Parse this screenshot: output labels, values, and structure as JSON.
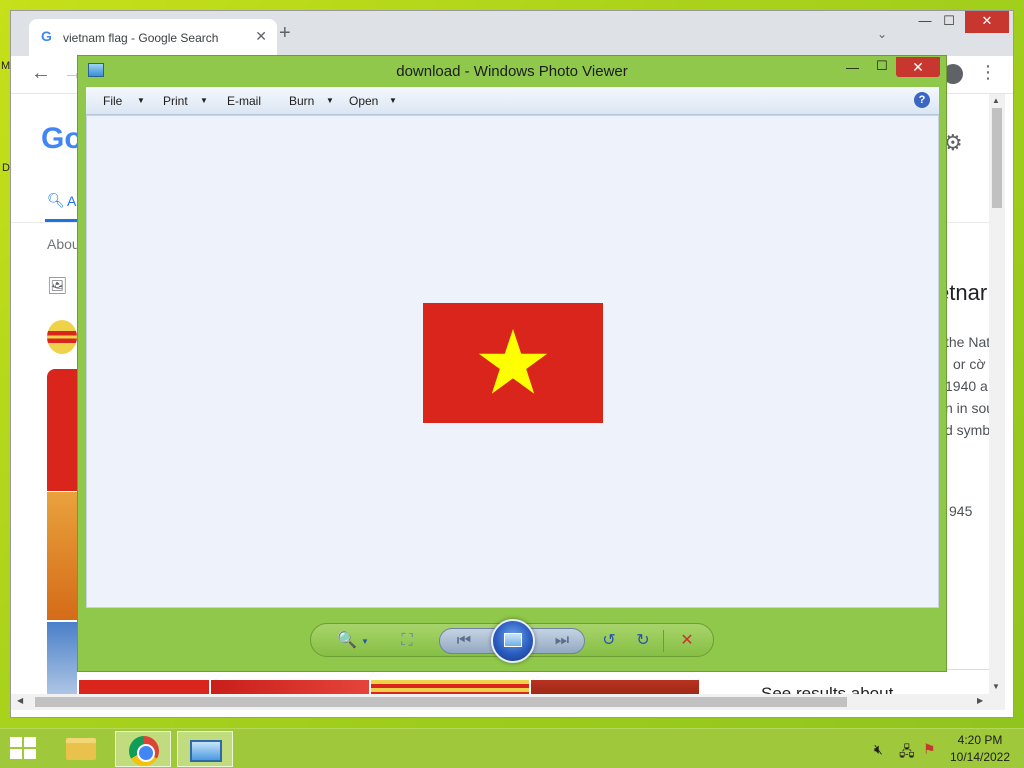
{
  "desktop": {
    "edge_text_top": "M",
    "edge_text_mid": "D"
  },
  "chrome": {
    "tab_title": "vietnam flag - Google Search",
    "tab_favicon": "google-g-icon",
    "tab_close": "✕",
    "new_tab": "+",
    "tab_search": "⌄",
    "window_minimize": "—",
    "window_maximize": "☐",
    "window_close": "✕",
    "back": "←",
    "forward": "→",
    "menu": "⋮",
    "search_page": {
      "logo_partial": "Go",
      "tab_all_partial": "A",
      "about_partial": "About",
      "knowledge_panel_title_partial": "etnar",
      "knowledge_panel_lines": [
        "the Nat",
        "or cờ",
        "1940 a",
        "n in sou",
        "d symbo",
        "945"
      ],
      "see_results": "See results about"
    }
  },
  "photo_viewer": {
    "title": "download - Windows Photo Viewer",
    "menu": [
      {
        "label": "File",
        "has_dropdown": true
      },
      {
        "label": "Print",
        "has_dropdown": true
      },
      {
        "label": "E-mail",
        "has_dropdown": false
      },
      {
        "label": "Burn",
        "has_dropdown": true
      },
      {
        "label": "Open",
        "has_dropdown": true
      }
    ],
    "help": "?",
    "minimize": "—",
    "maximize": "☐",
    "close": "✕",
    "image": {
      "description_colors": {
        "field": "#da251d",
        "star": "#ffff00"
      }
    },
    "controls": {
      "zoom": "🔍",
      "actual_size": "⛶",
      "previous": "⏮",
      "next": "⏭",
      "rotate_ccw": "↺",
      "rotate_cw": "↻",
      "delete": "✕"
    }
  },
  "taskbar": {
    "clock_time": "4:20 PM",
    "clock_date": "10/14/2022",
    "items": [
      "file-explorer",
      "google-chrome",
      "windows-photo-viewer"
    ]
  },
  "colors": {
    "photo_viewer_frame": "#8fc84a",
    "taskbar": "#9fc93a",
    "close_red": "#c7372f",
    "google_blue": "#1a73e8"
  }
}
